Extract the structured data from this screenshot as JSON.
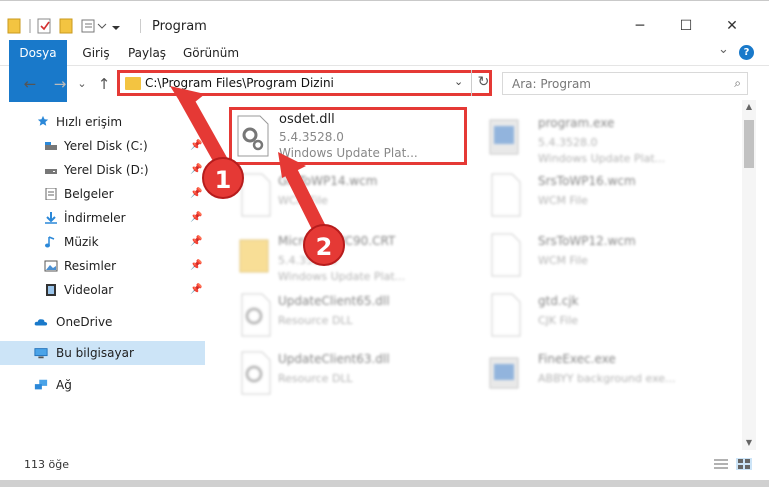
{
  "window": {
    "title": "Program",
    "minimize_glyph": "─",
    "maximize_glyph": "☐",
    "close_glyph": "✕"
  },
  "ribbon": {
    "tabs": [
      "Dosya",
      "Giriş",
      "Paylaş",
      "Görünüm"
    ],
    "expand_glyph": "⌄",
    "help_glyph": "?"
  },
  "address_bar": {
    "path": "C:\\Program Files\\Program Dizini",
    "back_glyph": "←",
    "forward_glyph": "→",
    "recent_glyph": "⌄",
    "up_glyph": "↑",
    "refresh_glyph": "↻",
    "dropdown_glyph": "⌄"
  },
  "search": {
    "placeholder": "Ara: Program",
    "icon_glyph": "⌕"
  },
  "nav": {
    "quick_access": "Hızlı erişim",
    "items": [
      {
        "label": "Yerel Disk (C:)",
        "icon": "drive-icon",
        "pinned": true
      },
      {
        "label": "Yerel Disk (D:)",
        "icon": "drive-icon",
        "pinned": true
      },
      {
        "label": "Belgeler",
        "icon": "documents-icon",
        "pinned": true
      },
      {
        "label": "İndirmeler",
        "icon": "download-icon",
        "pinned": true
      },
      {
        "label": "Müzik",
        "icon": "music-icon",
        "pinned": true
      },
      {
        "label": "Resimler",
        "icon": "pictures-icon",
        "pinned": true
      },
      {
        "label": "Videolar",
        "icon": "videos-icon",
        "pinned": true
      }
    ],
    "onedrive": "OneDrive",
    "this_pc": "Bu bilgisayar",
    "network": "Ağ",
    "pin_glyph": "📌"
  },
  "files": {
    "highlighted": {
      "name": "osdet.dll",
      "version": "5.4.3528.0",
      "description": "Windows Update Plat..."
    },
    "others": [
      {
        "name": "program.exe",
        "line2": "5.4.3528.0",
        "line3": "Windows Update Plat..."
      },
      {
        "name": "GrsToWP14.wcm",
        "line2": "WCM File",
        "line3": ""
      },
      {
        "name": "SrsToWP16.wcm",
        "line2": "WCM File",
        "line3": ""
      },
      {
        "name": "Microsoft.VC90.CRT",
        "line2": "5.4.3528.0",
        "line3": "Windows Update Plat..."
      },
      {
        "name": "SrsToWP12.wcm",
        "line2": "WCM File",
        "line3": ""
      },
      {
        "name": "UpdateClient65.dll",
        "line2": "Resource DLL",
        "line3": ""
      },
      {
        "name": "gtd.cjk",
        "line2": "CJK File",
        "line3": ""
      },
      {
        "name": "UpdateClient63.dll",
        "line2": "Resource DLL",
        "line3": ""
      },
      {
        "name": "FineExec.exe",
        "line2": "ABBYY background exe...",
        "line3": ""
      }
    ]
  },
  "status": {
    "item_count": "113 öğe"
  },
  "callouts": [
    "1",
    "2"
  ],
  "colors": {
    "accent": "#1979ca",
    "highlight_red": "#e53935",
    "nav_selected": "#cce4f7"
  }
}
